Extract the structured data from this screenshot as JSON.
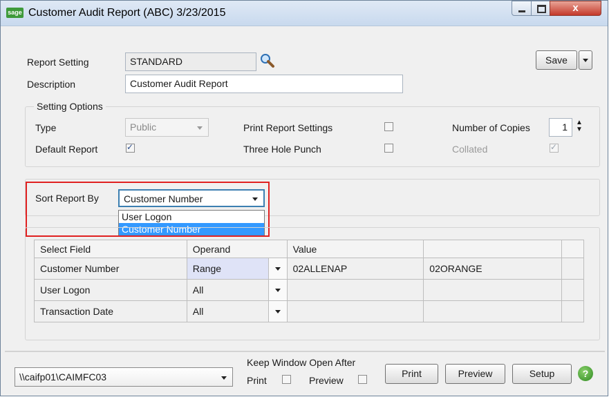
{
  "window": {
    "title": "Customer Audit Report (ABC) 3/23/2015",
    "app_icon_text": "sage",
    "close_glyph": "x"
  },
  "report": {
    "setting_label": "Report Setting",
    "setting_value": "STANDARD",
    "description_label": "Description",
    "description_value": "Customer Audit Report",
    "save_label": "Save",
    "save_menu_icon": "chevron-down-icon"
  },
  "options": {
    "group_label": "Setting Options",
    "type_label": "Type",
    "type_value": "Public",
    "default_report_label": "Default Report",
    "default_report_checked": true,
    "print_settings_label": "Print Report Settings",
    "print_settings_checked": false,
    "three_hole_label": "Three Hole Punch",
    "three_hole_checked": false,
    "copies_label": "Number of Copies",
    "copies_value": "1",
    "collated_label": "Collated",
    "collated_checked": true
  },
  "sort": {
    "label": "Sort Report By",
    "value": "Customer Number",
    "options": [
      "User Logon",
      "Customer Number"
    ],
    "highlight_color": "#e02020"
  },
  "grid": {
    "columns": [
      "Select Field",
      "Operand",
      "Value",
      ""
    ],
    "rows": [
      {
        "field": "Customer Number",
        "operand": "Range",
        "value": "02ALLENAP",
        "value2": "02ORANGE"
      },
      {
        "field": "User Logon",
        "operand": "All",
        "value": "",
        "value2": ""
      },
      {
        "field": "Transaction Date",
        "operand": "All",
        "value": "",
        "value2": ""
      }
    ]
  },
  "footer": {
    "printer": "\\\\caifp01\\CAIMFC03",
    "keep_open_label": "Keep Window Open After",
    "print_label": "Print",
    "preview_label": "Preview",
    "print_button": "Print",
    "preview_button": "Preview",
    "setup_button": "Setup",
    "help_icon": "help-icon"
  },
  "colors": {
    "accent_selection": "#3399ff",
    "title_gradient_top": "#dfe9f5"
  }
}
